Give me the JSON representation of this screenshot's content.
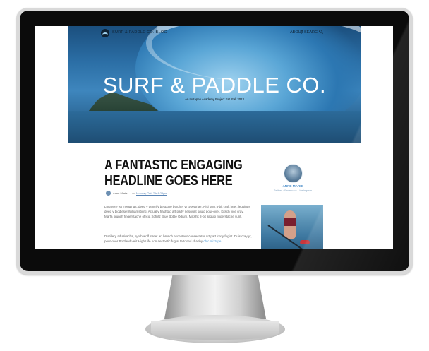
{
  "site": {
    "blog_name": "SURF & PADDLE CO. BLOG",
    "nav": {
      "about": "ABOUT",
      "separator": "|",
      "search": "SEARCH"
    },
    "hero_title": "SURF & PADDLE CO.",
    "hero_subtitle": "An Instapen Academy Project Est. Fall 2013"
  },
  "article": {
    "headline_line1": "A FANTASTIC ENGAGING",
    "headline_line2": "HEADLINE GOES HERE",
    "author": "Anne Marie",
    "on": "on",
    "date": "Monday Oct. 7th 8:25pm",
    "paragraph1": "Locavore ea meggings, deep v gentrify bespoke butcher yr typewriter. Nisi sunt 8-bit craft beer, leggings deep v biodiesel Williamsburg. Actually hashtag art party nesciunt squid pour-over. Kitsch vice cray, Marfa brunch fingerstache officia Schlitz Blue Bottle Odium. Mikshk 8-bit aliquip fingerstache sunt.",
    "paragraph2": "Distillery ad sriracha, synth wolf street art brunch excepteur consectetur art part irony fugiat. Duis cray yr, pour-over Portland velit High Life non aesthetic fugiat tattooed shabby",
    "read_more": "chic mixtape."
  },
  "sidebar": {
    "author_name": "ANNE MARIE",
    "author_links": "Twitter · Facebook · Instagram"
  },
  "icons": {
    "logo": "wave-logo-icon",
    "search": "search-icon"
  },
  "colors": {
    "accent_blue": "#4e8fc9",
    "hero_title": "#ffffff",
    "monitor_bezel": "#0b0b0b"
  }
}
